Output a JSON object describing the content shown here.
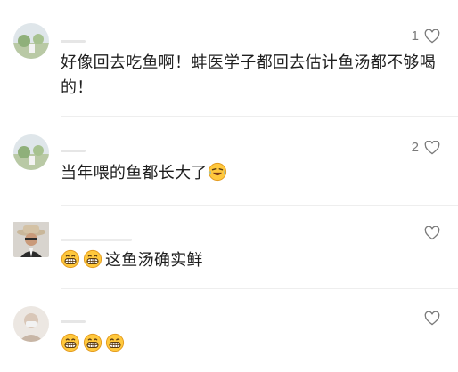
{
  "comments": [
    {
      "likes": "1",
      "text": "好像回去吃鱼啊！蚌医学子都回去估计鱼汤都不够喝的！",
      "avatar_icon": "landscape-avatar-icon",
      "emojis": []
    },
    {
      "likes": "2",
      "text": "当年喂的鱼都长大了",
      "avatar_icon": "landscape-avatar-icon",
      "emojis": [
        "laughing-crying-emoji"
      ]
    },
    {
      "likes": "",
      "text": "这鱼汤确实鲜",
      "avatar_icon": "cowboy-hat-avatar-icon",
      "emojis": [
        "grinning-emoji",
        "grinning-emoji"
      ]
    },
    {
      "likes": "",
      "text": "",
      "avatar_icon": "person-avatar-icon",
      "emojis": [
        "grinning-emoji",
        "grinning-emoji",
        "grinning-emoji"
      ]
    }
  ],
  "colors": {
    "text": "#1f1f1f",
    "muted": "#7a7a7a",
    "divider": "#eeeeee",
    "emoji_yellow": "#ffc83d"
  }
}
